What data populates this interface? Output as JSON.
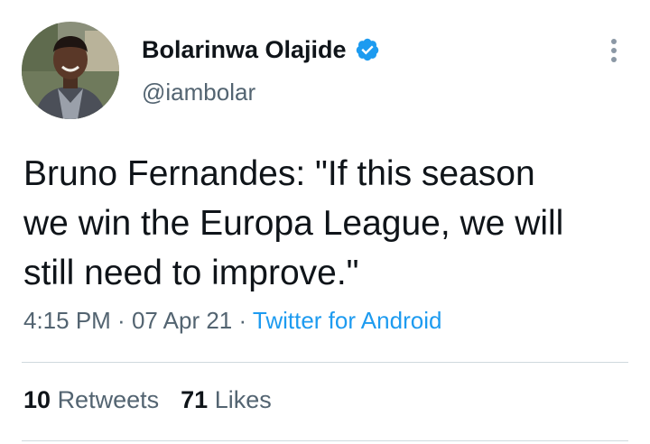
{
  "user": {
    "display_name": "Bolarinwa Olajide",
    "handle": "@iambolar",
    "verified_icon": "verified-badge-icon"
  },
  "tweet": {
    "lines": [
      "Bruno Fernandes: \"If this season",
      "we win the Europa League, we will",
      "still need to improve.\""
    ],
    "time": "4:15 PM",
    "sep1": " · ",
    "date": "07 Apr 21",
    "sep2": " · ",
    "source": "Twitter for Android"
  },
  "stats": {
    "retweets_count": "10",
    "retweets_label": "Retweets",
    "likes_count": "71",
    "likes_label": "Likes"
  },
  "colors": {
    "accent": "#1d9bf0",
    "text_primary": "#0f1419",
    "text_secondary": "#536471",
    "divider": "#cfd9de"
  }
}
